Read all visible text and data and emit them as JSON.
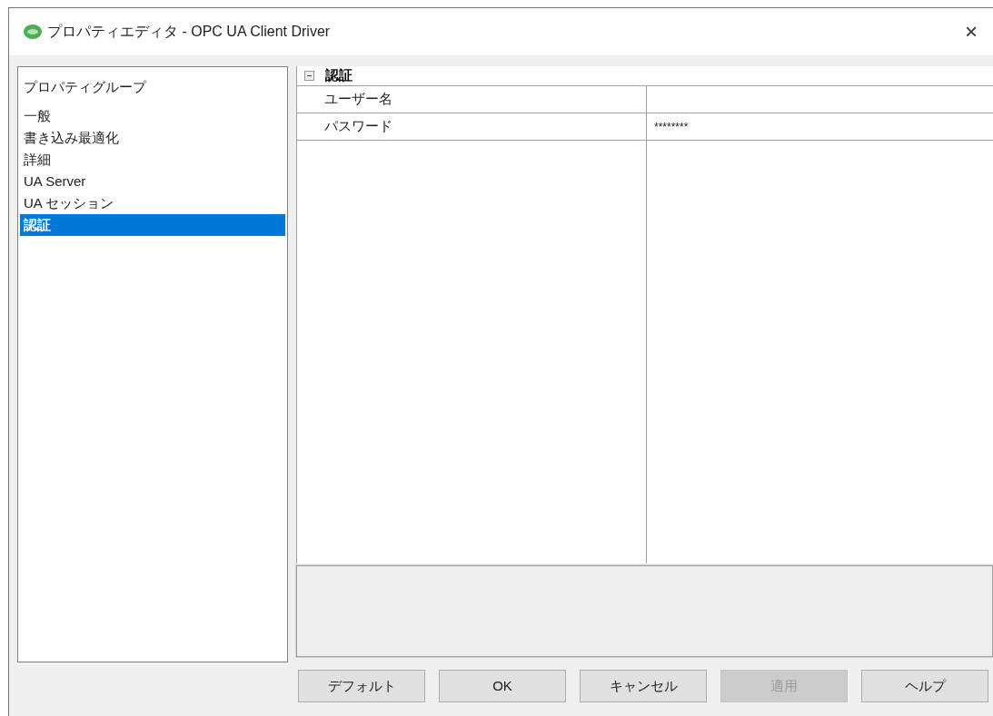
{
  "window": {
    "title": "プロパティエディタ - OPC UA Client Driver",
    "close": "×"
  },
  "sidebar": {
    "header": "プロパティグループ",
    "items": [
      {
        "label": "一般",
        "selected": false
      },
      {
        "label": "書き込み最適化",
        "selected": false
      },
      {
        "label": "詳細",
        "selected": false
      },
      {
        "label": "UA Server",
        "selected": false
      },
      {
        "label": "UA セッション",
        "selected": false
      },
      {
        "label": "認証",
        "selected": true
      }
    ]
  },
  "grid": {
    "category": {
      "label": "認証",
      "expanded": true
    },
    "rows": [
      {
        "name": "ユーザー名"
      },
      {
        "name": "パスワード",
        "value": "********"
      }
    ]
  },
  "buttons": [
    {
      "label": "デフォルト",
      "disabled": false
    },
    {
      "label": "OK",
      "disabled": false
    },
    {
      "label": "キャンセル",
      "disabled": false
    },
    {
      "label": "適用",
      "disabled": true
    },
    {
      "label": "ヘルプ",
      "disabled": false
    }
  ]
}
